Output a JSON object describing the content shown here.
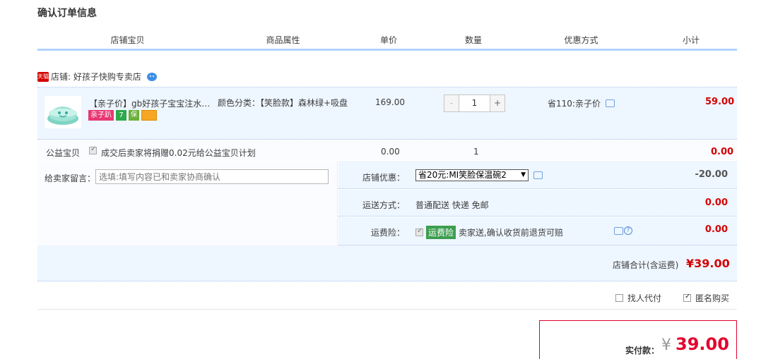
{
  "section_title": "确认订单信息",
  "columns": [
    "店铺宝贝",
    "商品属性",
    "单价",
    "数量",
    "优惠方式",
    "小计"
  ],
  "shop": {
    "badge": "天猫",
    "label": "店铺: 好孩子快购专卖店",
    "icon": "wangwang-chat-icon"
  },
  "item": {
    "title": "【亲子价】gb好孩子宝宝注水保...",
    "badges": [
      "亲子趴",
      "7",
      "保"
    ],
    "attr": "颜色分类：【笑脸款】森林绿+吸盘",
    "price": "169.00",
    "qty_minus": "-",
    "qty": "1",
    "qty_plus": "+",
    "discount": "省110:亲子价",
    "subtotal": "59.00"
  },
  "charity": {
    "label": "公益宝贝",
    "text": "成交后卖家将捐赠0.02元给公益宝贝计划",
    "price": "0.00",
    "qty": "1",
    "subtotal": "0.00"
  },
  "memo": {
    "label": "给卖家留言：",
    "placeholder": "选填:填写内容已和卖家协商确认"
  },
  "shop_discount": {
    "label": "店铺优惠：",
    "selected": "省20元:MI笑脸保温碗2",
    "amount": "-20.00"
  },
  "shipping": {
    "label": "运送方式：",
    "value": "普通配送 快递 免邮",
    "amount": "0.00"
  },
  "insurance": {
    "label": "运费险：",
    "tag": "运费险",
    "text": "卖家送,确认收货前退货可赔",
    "amount": "0.00"
  },
  "shop_total": {
    "label": "店铺合计(含运费)",
    "value": "¥39.00"
  },
  "options": {
    "agent_pay": "找人代付",
    "anonymous": "匿名购买"
  },
  "payment": {
    "label": "实付款：",
    "currency": "¥",
    "value": "39.00"
  },
  "colors": {
    "accent_blue": "#b2d1ff",
    "price_red": "#d40000",
    "row_bg": "#eef6ff"
  }
}
